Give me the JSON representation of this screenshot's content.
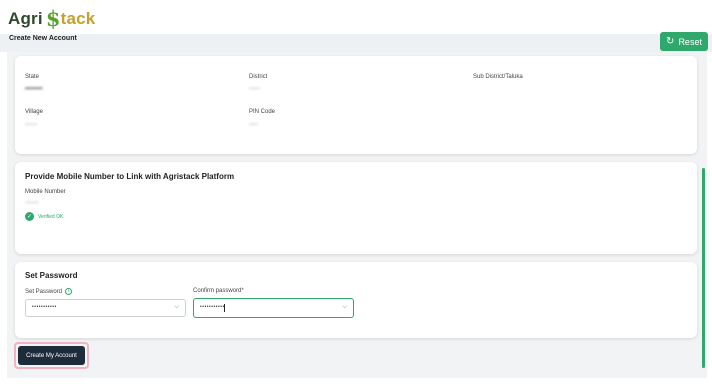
{
  "brand": {
    "logo_agri": "Agri",
    "logo_s": "$",
    "logo_tack": "tack"
  },
  "header": {
    "title": "Create New Account",
    "reset_label": "Reset"
  },
  "location": {
    "state_label": "State",
    "state_value": "••••••••••",
    "district_label": "District",
    "district_value": "••••••",
    "subdistrict_label": "Sub District/Taluka",
    "village_label": "Village",
    "village_value": "•••••••",
    "pincode_label": "PIN Code",
    "pincode_value": "•••••"
  },
  "mobile": {
    "heading": "Provide Mobile Number to Link with Agristack Platform",
    "label": "Mobile Number",
    "value": "••••••••",
    "verified_text": "Verified OK"
  },
  "password": {
    "heading": "Set Password",
    "set_label": "Set Password",
    "set_value": "•••••••••••",
    "confirm_label": "Confirm password*",
    "confirm_value": "•••••••••••"
  },
  "actions": {
    "create_label": "Create My Account"
  },
  "colors": {
    "accent": "#2fa86c",
    "primary_button": "#1d2b3a",
    "highlight": "#f0b3c4"
  }
}
